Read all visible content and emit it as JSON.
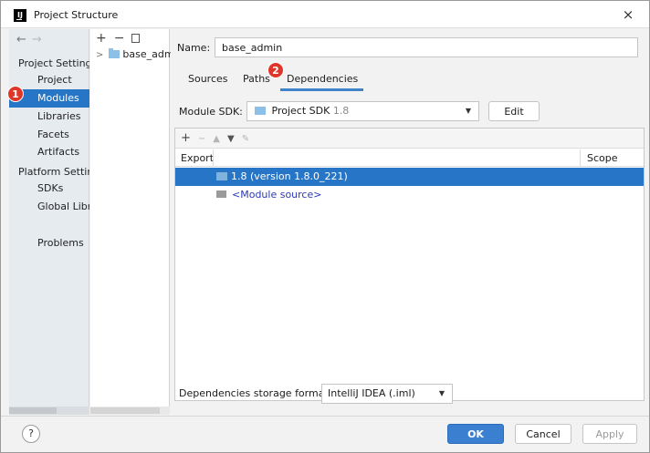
{
  "window": {
    "title": "Project Structure",
    "app_icon": "IJ",
    "close_glyph": "×"
  },
  "nav": {
    "back_glyph": "←",
    "forward_glyph": "→",
    "project_settings_header": "Project Settings",
    "project_items": [
      "Project",
      "Modules",
      "Libraries",
      "Facets",
      "Artifacts"
    ],
    "platform_settings_header": "Platform Settings",
    "platform_items": [
      "SDKs",
      "Global Libraries"
    ],
    "problems": "Problems",
    "selected": "Modules",
    "badge_1": "1"
  },
  "tree": {
    "add_glyph": "+",
    "remove_glyph": "−",
    "module_name": "base_admin"
  },
  "module": {
    "name_label": "Name:",
    "name_value": "base_admin",
    "tabs": [
      "Sources",
      "Paths",
      "Dependencies"
    ],
    "active_tab": "Dependencies",
    "badge_2": "2",
    "sdk_label": "Module SDK:",
    "sdk_value": "Project SDK",
    "sdk_version": "1.8",
    "edit_label": "Edit",
    "toolbar": {
      "add": "+",
      "remove": "−",
      "up": "▲",
      "down": "▼",
      "edit": "✎"
    },
    "columns": {
      "export": "Export",
      "scope": "Scope"
    },
    "dependencies": [
      "1.8 (version 1.8.0_221)",
      "<Module source>"
    ],
    "storage_label": "Dependencies storage format:",
    "storage_value": "IntelliJ IDEA (.iml)"
  },
  "footer": {
    "help": "?",
    "ok": "OK",
    "cancel": "Cancel",
    "apply": "Apply"
  },
  "colors": {
    "selection": "#2675c7",
    "badge": "#e0362a",
    "primary_button": "#3a7fd0"
  }
}
